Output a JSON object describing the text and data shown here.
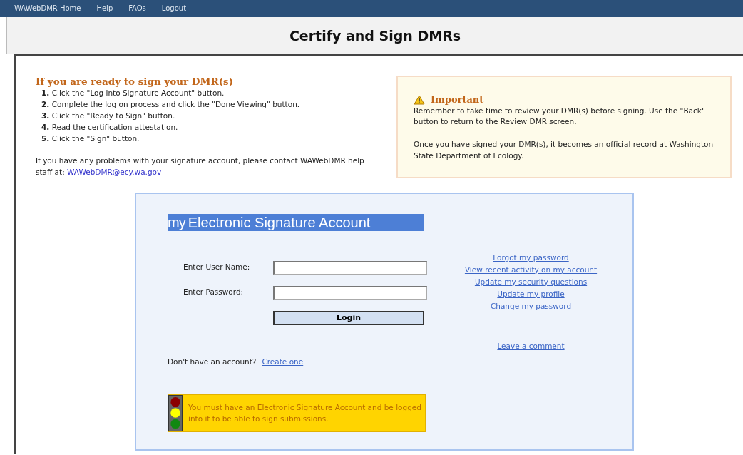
{
  "nav": [
    "WAWebDMR Home",
    "Help",
    "FAQs",
    "Logout"
  ],
  "page_title": "Certify and Sign DMRs",
  "instructions": {
    "heading": "If you are ready to sign your DMR(s)",
    "steps": [
      {
        "number": "1.",
        "text": "Click the \"Log into Signature Account\" button."
      },
      {
        "number": "2.",
        "text": "Complete the log on process and click the \"Done Viewing\" button."
      },
      {
        "number": "3.",
        "text": "Click the \"Ready to Sign\" button."
      },
      {
        "number": "4.",
        "text": "Read the certification attestation."
      },
      {
        "number": "5.",
        "text": "Click the \"Sign\" button."
      }
    ],
    "help_text": "If you have any problems with your signature account, please contact WAWebDMR help staff at:",
    "help_email": "WAWebDMR@ecy.wa.gov"
  },
  "important": {
    "title": "Important",
    "paragraphs": [
      "Remember to take time to review your DMR(s) before signing. Use the \"Back\" button to return to the Review DMR screen.",
      "Once you have signed your DMR(s), it becomes an official record at Washington State Department of Ecology."
    ]
  },
  "login": {
    "header_prefix": "my",
    "header": "Electronic Signature Account",
    "fields": [
      {
        "label": "Enter User Name:"
      },
      {
        "label": "Enter Password:"
      }
    ],
    "button": "Login",
    "no_account": "Don't have an account?",
    "create_link": "Create one",
    "links": [
      "Forgot my password",
      "View recent activity on my account",
      "Update my security questions",
      "Update my profile",
      "Change my password"
    ],
    "comment_link": "Leave a comment",
    "notice": "You must have an Electronic Signature Account and be logged into it to be able to sign submissions."
  }
}
